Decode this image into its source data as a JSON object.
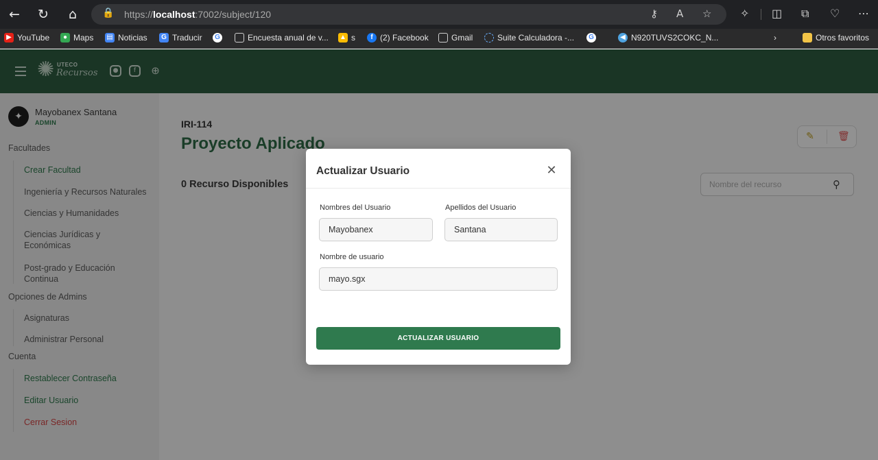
{
  "browser": {
    "url_prefix": "https://",
    "url_host": "localhost",
    "url_rest": ":7002/subject/120",
    "bookmarks": [
      {
        "label": "YouTube",
        "icon": "youtube-icon",
        "color": "#e62117"
      },
      {
        "label": "Maps",
        "icon": "maps-icon",
        "color": "#34a853"
      },
      {
        "label": "Noticias",
        "icon": "news-icon",
        "color": "#4285f4"
      },
      {
        "label": "Traducir",
        "icon": "translate-icon",
        "color": "#4285f4"
      },
      {
        "label": "",
        "icon": "google-icon",
        "color": "#ffffff"
      },
      {
        "label": "Encuesta anual de v...",
        "icon": "page-icon",
        "color": "#2b2b2c"
      },
      {
        "label": "s",
        "icon": "drive-icon",
        "color": "#fbbc04"
      },
      {
        "label": "(2) Facebook",
        "icon": "facebook-icon",
        "color": "#1877f2"
      },
      {
        "label": "Gmail",
        "icon": "page-icon",
        "color": "#2b2b2c"
      },
      {
        "label": "Suite Calculadora -...",
        "icon": "loading-icon",
        "color": "#2b2b2c"
      },
      {
        "label": "",
        "icon": "google-icon",
        "color": "#ffffff"
      },
      {
        "label": "N920TUVS2COKC_N...",
        "icon": "cloud-icon",
        "color": "#4fa3e0"
      }
    ],
    "other_favorites": "Otros favoritos"
  },
  "user": {
    "name": "Mayobanex Santana",
    "role": "ADMIN"
  },
  "sidebar": {
    "sections": [
      {
        "title": "Facultades",
        "items": [
          {
            "label": "Crear Facultad",
            "style": "green"
          },
          {
            "label": "Ingeniería y Recursos Naturales",
            "style": "normal"
          },
          {
            "label": "Ciencias y Humanidades",
            "style": "normal"
          },
          {
            "label": "Ciencias Jurídicas y Económicas",
            "style": "normal"
          },
          {
            "label": "Post-grado y Educación Continua",
            "style": "normal"
          }
        ]
      },
      {
        "title": "Opciones de Admins",
        "items": [
          {
            "label": "Asignaturas",
            "style": "normal"
          },
          {
            "label": "Administrar Personal",
            "style": "normal"
          }
        ]
      },
      {
        "title": "Cuenta",
        "items": [
          {
            "label": "Restablecer Contraseña",
            "style": "green"
          },
          {
            "label": "Editar Usuario",
            "style": "green"
          },
          {
            "label": "Cerrar Sesion",
            "style": "red"
          }
        ]
      }
    ]
  },
  "header": {
    "logo_top": "UTECO",
    "logo_bottom": "Recursos"
  },
  "main": {
    "subject_code": "IRI-114",
    "subject_title": "Proyecto Aplicado",
    "resources_count": "0 Recurso Disponibles",
    "search_placeholder": "Nombre del recurso"
  },
  "modal": {
    "title": "Actualizar Usuario",
    "first_name_label": "Nombres del Usuario",
    "first_name_value": "Mayobanex",
    "last_name_label": "Apellidos del Usuario",
    "last_name_value": "Santana",
    "username_label": "Nombre de usuario",
    "username_value": "mayo.sgx",
    "submit_label": "ACTUALIZAR USUARIO"
  },
  "colors": {
    "brand_green": "#2e5e42",
    "accent_green": "#2f7a4e",
    "danger_red": "#d64545"
  }
}
